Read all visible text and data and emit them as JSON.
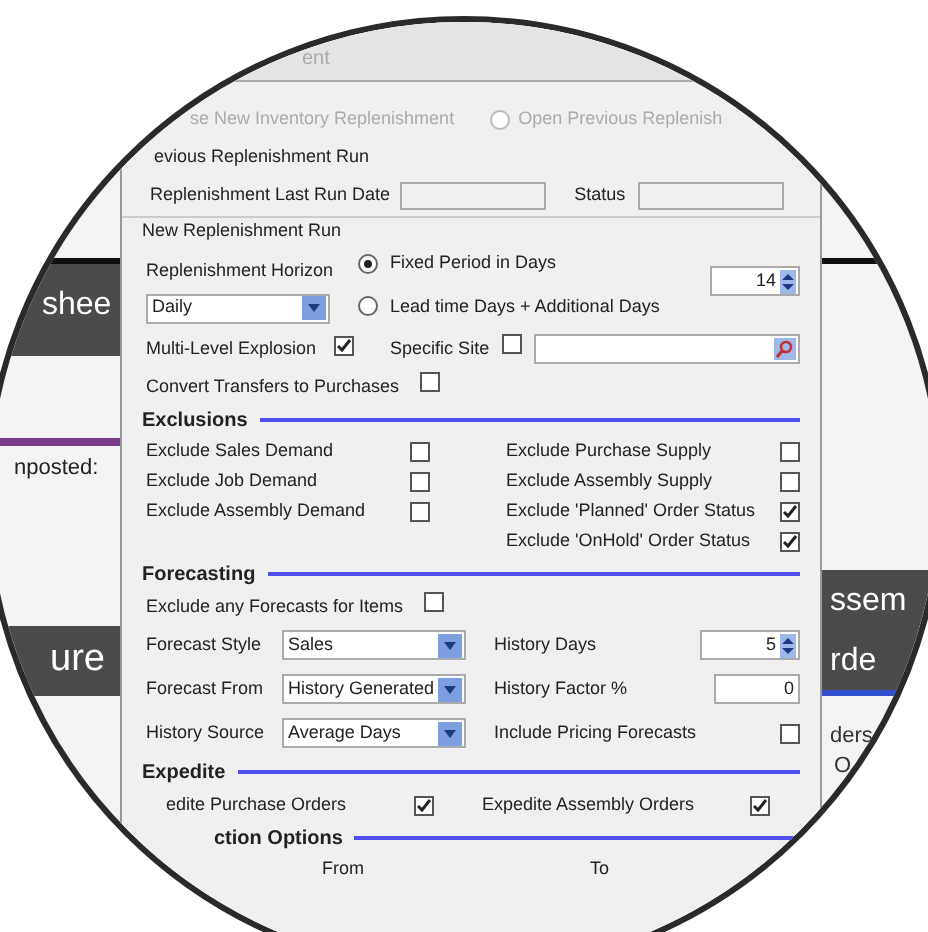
{
  "background": {
    "texts": [
      {
        "text": "shee"
      },
      {
        "text": "nposted:"
      },
      {
        "text": "ure"
      },
      {
        "text": "ssem"
      },
      {
        "text": "rde"
      },
      {
        "text": "ders"
      },
      {
        "text": "O"
      }
    ]
  },
  "dialog": {
    "title": "ent",
    "new_run_option": {
      "label": "se New Inventory Replenishment"
    },
    "open_previous_option": {
      "label": "Open Previous Replenish",
      "selected": false
    },
    "previous_run": {
      "heading": "evious Replenishment Run",
      "last_run_label": "Replenishment Last Run Date",
      "status_label": "Status"
    },
    "new_run": {
      "heading": "New Replenishment Run",
      "horizon_label": "Replenishment Horizon",
      "horizon_value": "Daily",
      "period_options": [
        {
          "label": "Fixed Period in Days",
          "selected": true
        },
        {
          "label": "Lead time Days + Additional Days",
          "selected": false
        }
      ],
      "days_value": "14",
      "multi_level": {
        "label": "Multi-Level Explosion",
        "checked": true
      },
      "specific_site": {
        "label": "Specific Site",
        "checked": false
      },
      "convert_transfers": {
        "label": "Convert Transfers to Purchases",
        "checked": false
      }
    },
    "exclusions": {
      "heading": "Exclusions",
      "left": [
        {
          "label": "Exclude Sales Demand",
          "checked": false
        },
        {
          "label": "Exclude Job Demand",
          "checked": false
        },
        {
          "label": "Exclude Assembly Demand",
          "checked": false
        }
      ],
      "right": [
        {
          "label": "Exclude Purchase  Supply",
          "checked": false
        },
        {
          "label": "Exclude Assembly  Supply",
          "checked": false
        },
        {
          "label": "Exclude 'Planned' Order Status",
          "checked": true
        },
        {
          "label": "Exclude 'OnHold' Order Status",
          "checked": true
        }
      ]
    },
    "forecasting": {
      "heading": "Forecasting",
      "exclude_forecasts": {
        "label": "Exclude any Forecasts for Items",
        "checked": false
      },
      "selects": [
        {
          "label": "Forecast Style",
          "value": "Sales"
        },
        {
          "label": "Forecast From",
          "value": "History Generated"
        },
        {
          "label": "History Source",
          "value": "Average Days"
        }
      ],
      "history_days": {
        "label": "History Days",
        "value": "5"
      },
      "history_factor": {
        "label": "History Factor %",
        "value": "0"
      },
      "include_pricing": {
        "label": "Include Pricing Forecasts",
        "checked": false
      }
    },
    "expedite": {
      "heading": "Expedite",
      "purchase": {
        "label": "edite Purchase Orders",
        "checked": true
      },
      "assembly": {
        "label": "Expedite Assembly Orders",
        "checked": true
      }
    },
    "selection": {
      "heading": "ction Options",
      "from_label": "From",
      "to_label": "To"
    }
  }
}
